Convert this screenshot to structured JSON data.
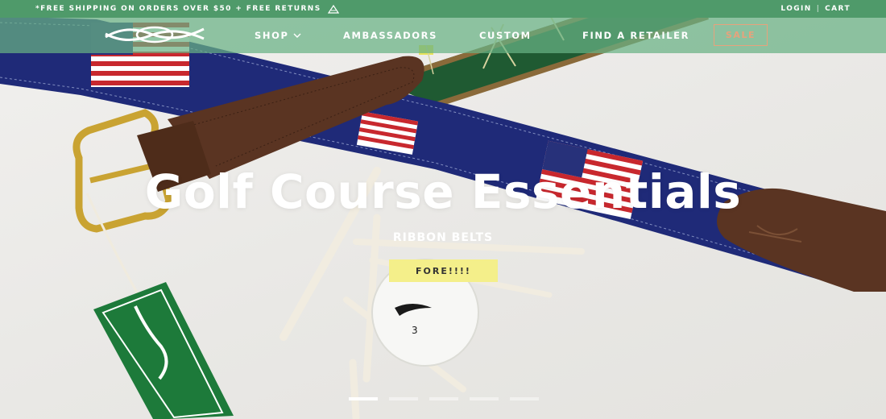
{
  "promo": {
    "text": "*FREE SHIPPING ON ORDERS OVER $50 + FREE RETURNS",
    "icon": "mountain-logo-icon"
  },
  "account": {
    "login_label": "LOGIN",
    "separator": "|",
    "cart_label": "CART"
  },
  "nav": {
    "logo": "knot-logo",
    "items": [
      {
        "label": "SHOP",
        "icon": "chevron-down-icon"
      },
      {
        "label": "AMBASSADORS"
      },
      {
        "label": "CUSTOM"
      },
      {
        "label": "FIND A RETAILER"
      }
    ],
    "sale_label": "SALE"
  },
  "hero": {
    "title": "Golf Course Essentials",
    "subtitle": "RIBBON BELTS",
    "cta_label": "FORE!!!!",
    "slides_count": 5,
    "active_slide": 1
  },
  "colors": {
    "promo_bar": "#4f9a6a",
    "nav_bar": "#68b184",
    "sale_accent": "#e7a27c",
    "cta_background": "#f4ef8a",
    "belt_navy": "#1f2a78",
    "belt_green": "#1f5a32",
    "leather_brown": "#5a3422"
  }
}
